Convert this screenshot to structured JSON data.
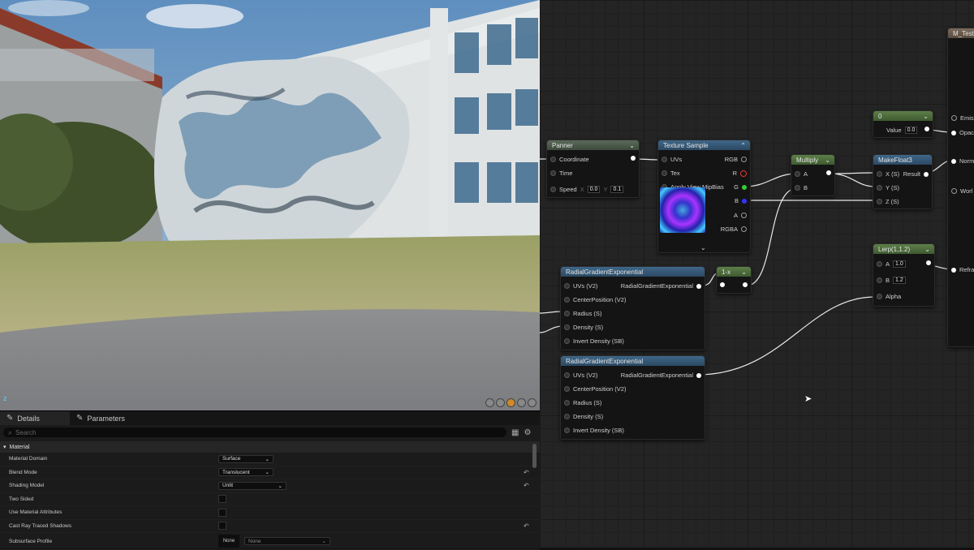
{
  "details": {
    "tabs": [
      {
        "label": "Details",
        "icon": "pencil-icon"
      },
      {
        "label": "Parameters",
        "icon": "pencil-icon"
      }
    ],
    "search_placeholder": "Search",
    "section": "Material",
    "properties": [
      {
        "label": "Material Domain",
        "value": "Surface"
      },
      {
        "label": "Blend Mode",
        "value": "Translucent"
      },
      {
        "label": "Shading Model",
        "value": "Unlit"
      },
      {
        "label": "Two Sided",
        "value": ""
      },
      {
        "label": "Use Material Attributes",
        "value": ""
      },
      {
        "label": "Cast Ray Traced Shadows",
        "value": ""
      },
      {
        "label": "Subsurface Profile",
        "value": "None",
        "thumb": "None"
      }
    ]
  },
  "graph": {
    "panner": {
      "title": "Panner",
      "pins": [
        "Coordinate",
        "Time",
        "Speed"
      ],
      "speed_x": "0.0",
      "speed_y": "0.1",
      "x_label": "X",
      "y_label": "Y"
    },
    "texture_sample": {
      "title": "Texture Sample",
      "inputs": [
        "UVs",
        "Tex",
        "Apply View MipBias"
      ],
      "outputs": [
        "RGB",
        "R",
        "G",
        "B",
        "A",
        "RGBA"
      ]
    },
    "multiply": {
      "title": "Multiply",
      "inputs": [
        "A",
        "B"
      ]
    },
    "makefloat3": {
      "title": "MakeFloat3",
      "inputs": [
        "X (S)",
        "Y (S)",
        "Z (S)"
      ],
      "output": "Result"
    },
    "constant": {
      "title": "0",
      "label": "Value",
      "value": "0.0"
    },
    "one_minus": {
      "title": "1-x"
    },
    "lerp": {
      "title": "Lerp(1,1.2)",
      "inputs": [
        "A",
        "B",
        "Alpha"
      ],
      "a": "1.0",
      "b": "1.2"
    },
    "radial1": {
      "title": "RadialGradientExponential",
      "inputs": [
        "UVs (V2)",
        "CenterPosition (V2)",
        "Radius (S)",
        "Density (S)",
        "Invert Density (SB)"
      ],
      "output": "RadialGradientExponential"
    },
    "radial2": {
      "title": "RadialGradientExponential",
      "inputs": [
        "UVs (V2)",
        "CenterPosition (V2)",
        "Radius (S)",
        "Density (S)",
        "Invert Density (SB)"
      ],
      "output": "RadialGradientExponential"
    },
    "material": {
      "title": "M_Test",
      "pins": [
        "Emis",
        "Opac",
        "Norm",
        "Worl",
        "Refra"
      ]
    }
  },
  "viewport": {
    "axis_label": "z"
  }
}
